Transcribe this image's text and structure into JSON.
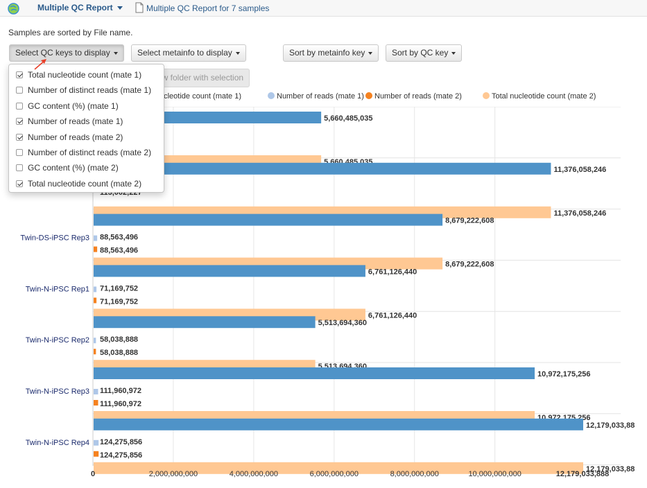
{
  "header": {
    "menu_label": "Multiple QC Report",
    "title": "Multiple QC Report for 7 samples"
  },
  "sort_note": "Samples are sorted by File name.",
  "toolbar": {
    "select_qc_label": "Select QC keys to display",
    "select_meta_label": "Select metainfo to display",
    "sort_meta_label": "Sort by metainfo key",
    "sort_qc_label": "Sort by QC key",
    "new_folder_label": "ew folder with selection"
  },
  "qc_dropdown": {
    "items": [
      {
        "label": "Total nucleotide count (mate 1)",
        "checked": true
      },
      {
        "label": "Number of distinct reads (mate 1)",
        "checked": false
      },
      {
        "label": "GC content (%) (mate 1)",
        "checked": false
      },
      {
        "label": "Number of reads (mate 1)",
        "checked": true
      },
      {
        "label": "Number of reads (mate 2)",
        "checked": true
      },
      {
        "label": "Number of distinct reads (mate 2)",
        "checked": false
      },
      {
        "label": "GC content (%) (mate 2)",
        "checked": false
      },
      {
        "label": "Total nucleotide count (mate 2)",
        "checked": true
      }
    ]
  },
  "legend": [
    {
      "label": "ucleotide count (mate 1)",
      "color": "#4f93c8"
    },
    {
      "label": "Number of reads (mate 1)",
      "color": "#aec7e8"
    },
    {
      "label": "Number of reads (mate 2)",
      "color": "#f58220"
    },
    {
      "label": "Total nucleotide count (mate 2)",
      "color": "#ffc893"
    }
  ],
  "colors": {
    "series1": "#4f93c8",
    "series2": "#aec7e8",
    "series3": "#f58220",
    "series4": "#ffc893"
  },
  "chart_data": {
    "type": "bar",
    "orientation": "horizontal",
    "categories": [
      "",
      "",
      "Twin-DS-iPSC Rep3",
      "Twin-N-iPSC Rep1",
      "Twin-N-iPSC Rep2",
      "Twin-N-iPSC Rep3",
      "Twin-N-iPSC Rep4"
    ],
    "series": [
      {
        "name": "Total nucleotide count (mate 1)",
        "values": [
          5660485035,
          11376058246,
          8679222608,
          6761126440,
          5513694360,
          10972175256,
          12179033888
        ],
        "labels": [
          "5,660,485,035",
          "11,376,058,246",
          "8,679,222,608",
          "6,761,126,440",
          "5,513,694,360",
          "10,972,175,256",
          "12,179,033,88"
        ]
      },
      {
        "name": "Number of reads (mate 1)",
        "values": [
          null,
          null,
          88563496,
          71169752,
          58038888,
          111960972,
          124275856
        ],
        "labels": [
          "",
          "",
          "88,563,496",
          "71,169,752",
          "58,038,888",
          "111,960,972",
          "124,275,856"
        ]
      },
      {
        "name": "Number of reads (mate 2)",
        "values": [
          null,
          113,
          60,
          0
        ],
        "labels": []
      },
      {
        "name": "Total nucleotide count (mate 2)",
        "values": [
          5660485035,
          11376058246,
          8679222608,
          6761126440,
          5513694360,
          10972175256,
          12179033888
        ],
        "labels": [
          "5,660,485,035",
          "11,376,058,246",
          "8,679,222,608",
          "6,761,126,440",
          "5,513,694,360",
          "10,972,175,256",
          "12,179,033,88"
        ]
      }
    ],
    "xlim": [
      0,
      12179033888
    ],
    "x_ticks": [
      "0",
      "2,000,000,000",
      "4,000,000,000",
      "6,000,000,000",
      "8,000,000,000",
      "10,000,000,000",
      "12,179,033,888"
    ],
    "x_tick_values": [
      0,
      2000000000,
      4000000000,
      6000000000,
      8000000000,
      10000000000,
      12179033888
    ],
    "partial_label": "113,002,227",
    "grid": true
  }
}
